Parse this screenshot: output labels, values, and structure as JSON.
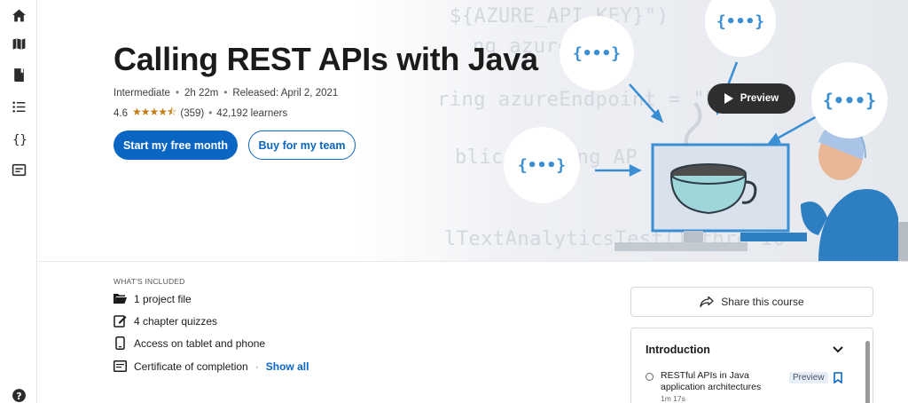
{
  "rail": {
    "items": [
      {
        "name": "home-icon"
      },
      {
        "name": "map-icon"
      },
      {
        "name": "book-icon"
      },
      {
        "name": "list-icon"
      },
      {
        "name": "code-icon"
      },
      {
        "name": "screen-icon"
      }
    ],
    "help": "help-icon"
  },
  "hero": {
    "title": "Calling REST APIs with Java",
    "level": "Intermediate",
    "duration": "2h 22m",
    "released": "Released: April 2, 2021",
    "rating": "4.6",
    "stars": "★★★★⯪",
    "reviews": "(359)",
    "learners": "42,192 learners",
    "primary_button": "Start my free month",
    "secondary_button": "Buy for my team",
    "preview_button": "Preview",
    "bubble_text": "{•••}",
    "code_lines": [
      "${AZURE_API_KEY}\")",
      "ng azureApi",
      "ring azureEndpoint = \"htt",
      "blic fi   ring AP       EADER_NAM",
      "lTextAnalyticsTest() thro   IO"
    ]
  },
  "included": {
    "heading": "WHAT'S INCLUDED",
    "items": [
      {
        "icon": "folder-icon",
        "label": "1 project file"
      },
      {
        "icon": "quiz-icon",
        "label": "4 chapter quizzes"
      },
      {
        "icon": "phone-icon",
        "label": "Access on tablet and phone"
      },
      {
        "icon": "certificate-icon",
        "label": "Certificate of completion"
      }
    ],
    "show_all": "Show all"
  },
  "sidebar": {
    "share_label": "Share this course",
    "toc": {
      "chapter": "Introduction",
      "lesson_title": "RESTful APIs in Java application architectures",
      "lesson_duration": "1m 17s",
      "lesson_badge": "Preview"
    }
  },
  "colors": {
    "accent": "#0a66c2",
    "star": "#c37d16",
    "bubble_text": "#3a8ed3"
  }
}
